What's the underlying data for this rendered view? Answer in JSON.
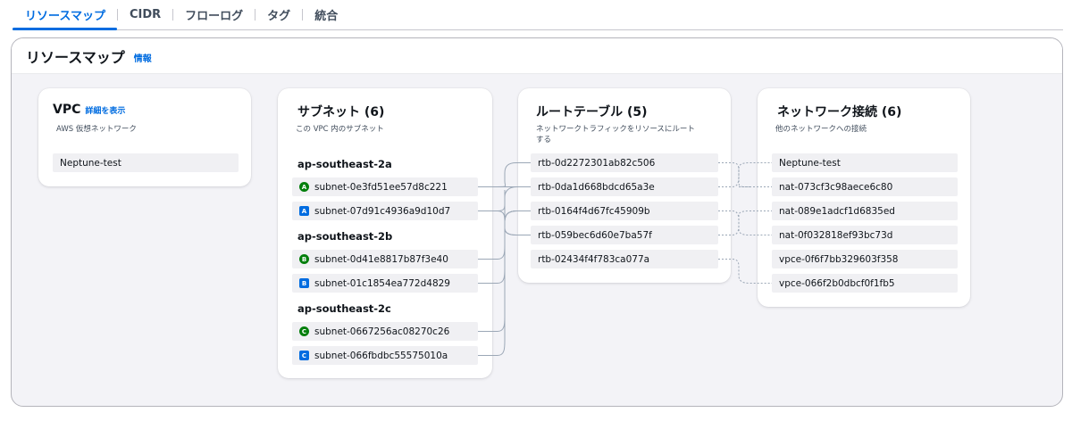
{
  "tabs": [
    {
      "label": "リソースマップ",
      "active": true
    },
    {
      "label": "CIDR"
    },
    {
      "label": "フローログ"
    },
    {
      "label": "タグ"
    },
    {
      "label": "統合"
    }
  ],
  "panel": {
    "title": "リソースマップ",
    "info": "情報"
  },
  "vpc": {
    "title": "VPC",
    "link": "詳細を表示",
    "desc": "AWS 仮想ネットワーク",
    "items": [
      "Neptune-test"
    ]
  },
  "subnets": {
    "title": "サブネット (6)",
    "desc": "この VPC 内のサブネット",
    "groups": [
      {
        "az": "ap-southeast-2a",
        "items": [
          {
            "badge": "A",
            "kind": "green",
            "id": "subnet-0e3fd51ee57d8c221"
          },
          {
            "badge": "A",
            "kind": "blue",
            "id": "subnet-07d91c4936a9d10d7"
          }
        ]
      },
      {
        "az": "ap-southeast-2b",
        "items": [
          {
            "badge": "B",
            "kind": "green",
            "id": "subnet-0d41e8817b87f3e40"
          },
          {
            "badge": "B",
            "kind": "blue",
            "id": "subnet-01c1854ea772d4829"
          }
        ]
      },
      {
        "az": "ap-southeast-2c",
        "items": [
          {
            "badge": "C",
            "kind": "green",
            "id": "subnet-0667256ac08270c26"
          },
          {
            "badge": "C",
            "kind": "blue",
            "id": "subnet-066fbdbc55575010a"
          }
        ]
      }
    ]
  },
  "route_tables": {
    "title": "ルートテーブル (5)",
    "desc_line1": "ネットワークトラフィックをリソースにルート",
    "desc_line2": "する",
    "items": [
      "rtb-0d2272301ab82c506",
      "rtb-0da1d668bdcd65a3e",
      "rtb-0164f4d67fc45909b",
      "rtb-059bec6d60e7ba57f",
      "rtb-02434f4f783ca077a"
    ]
  },
  "network": {
    "title": "ネットワーク接続 (6)",
    "desc": "他のネットワークへの接続",
    "items": [
      "Neptune-test",
      "nat-073cf3c98aece6c80",
      "nat-089e1adcf1d6835ed",
      "nat-0f032818ef93bc73d",
      "vpce-0f6f7bb329603f358",
      "vpce-066f2b0dbcf0f1fb5"
    ]
  },
  "colors": {
    "accent": "#006ce0",
    "green_badge": "#037f0c",
    "line": "#9ba7b6"
  }
}
